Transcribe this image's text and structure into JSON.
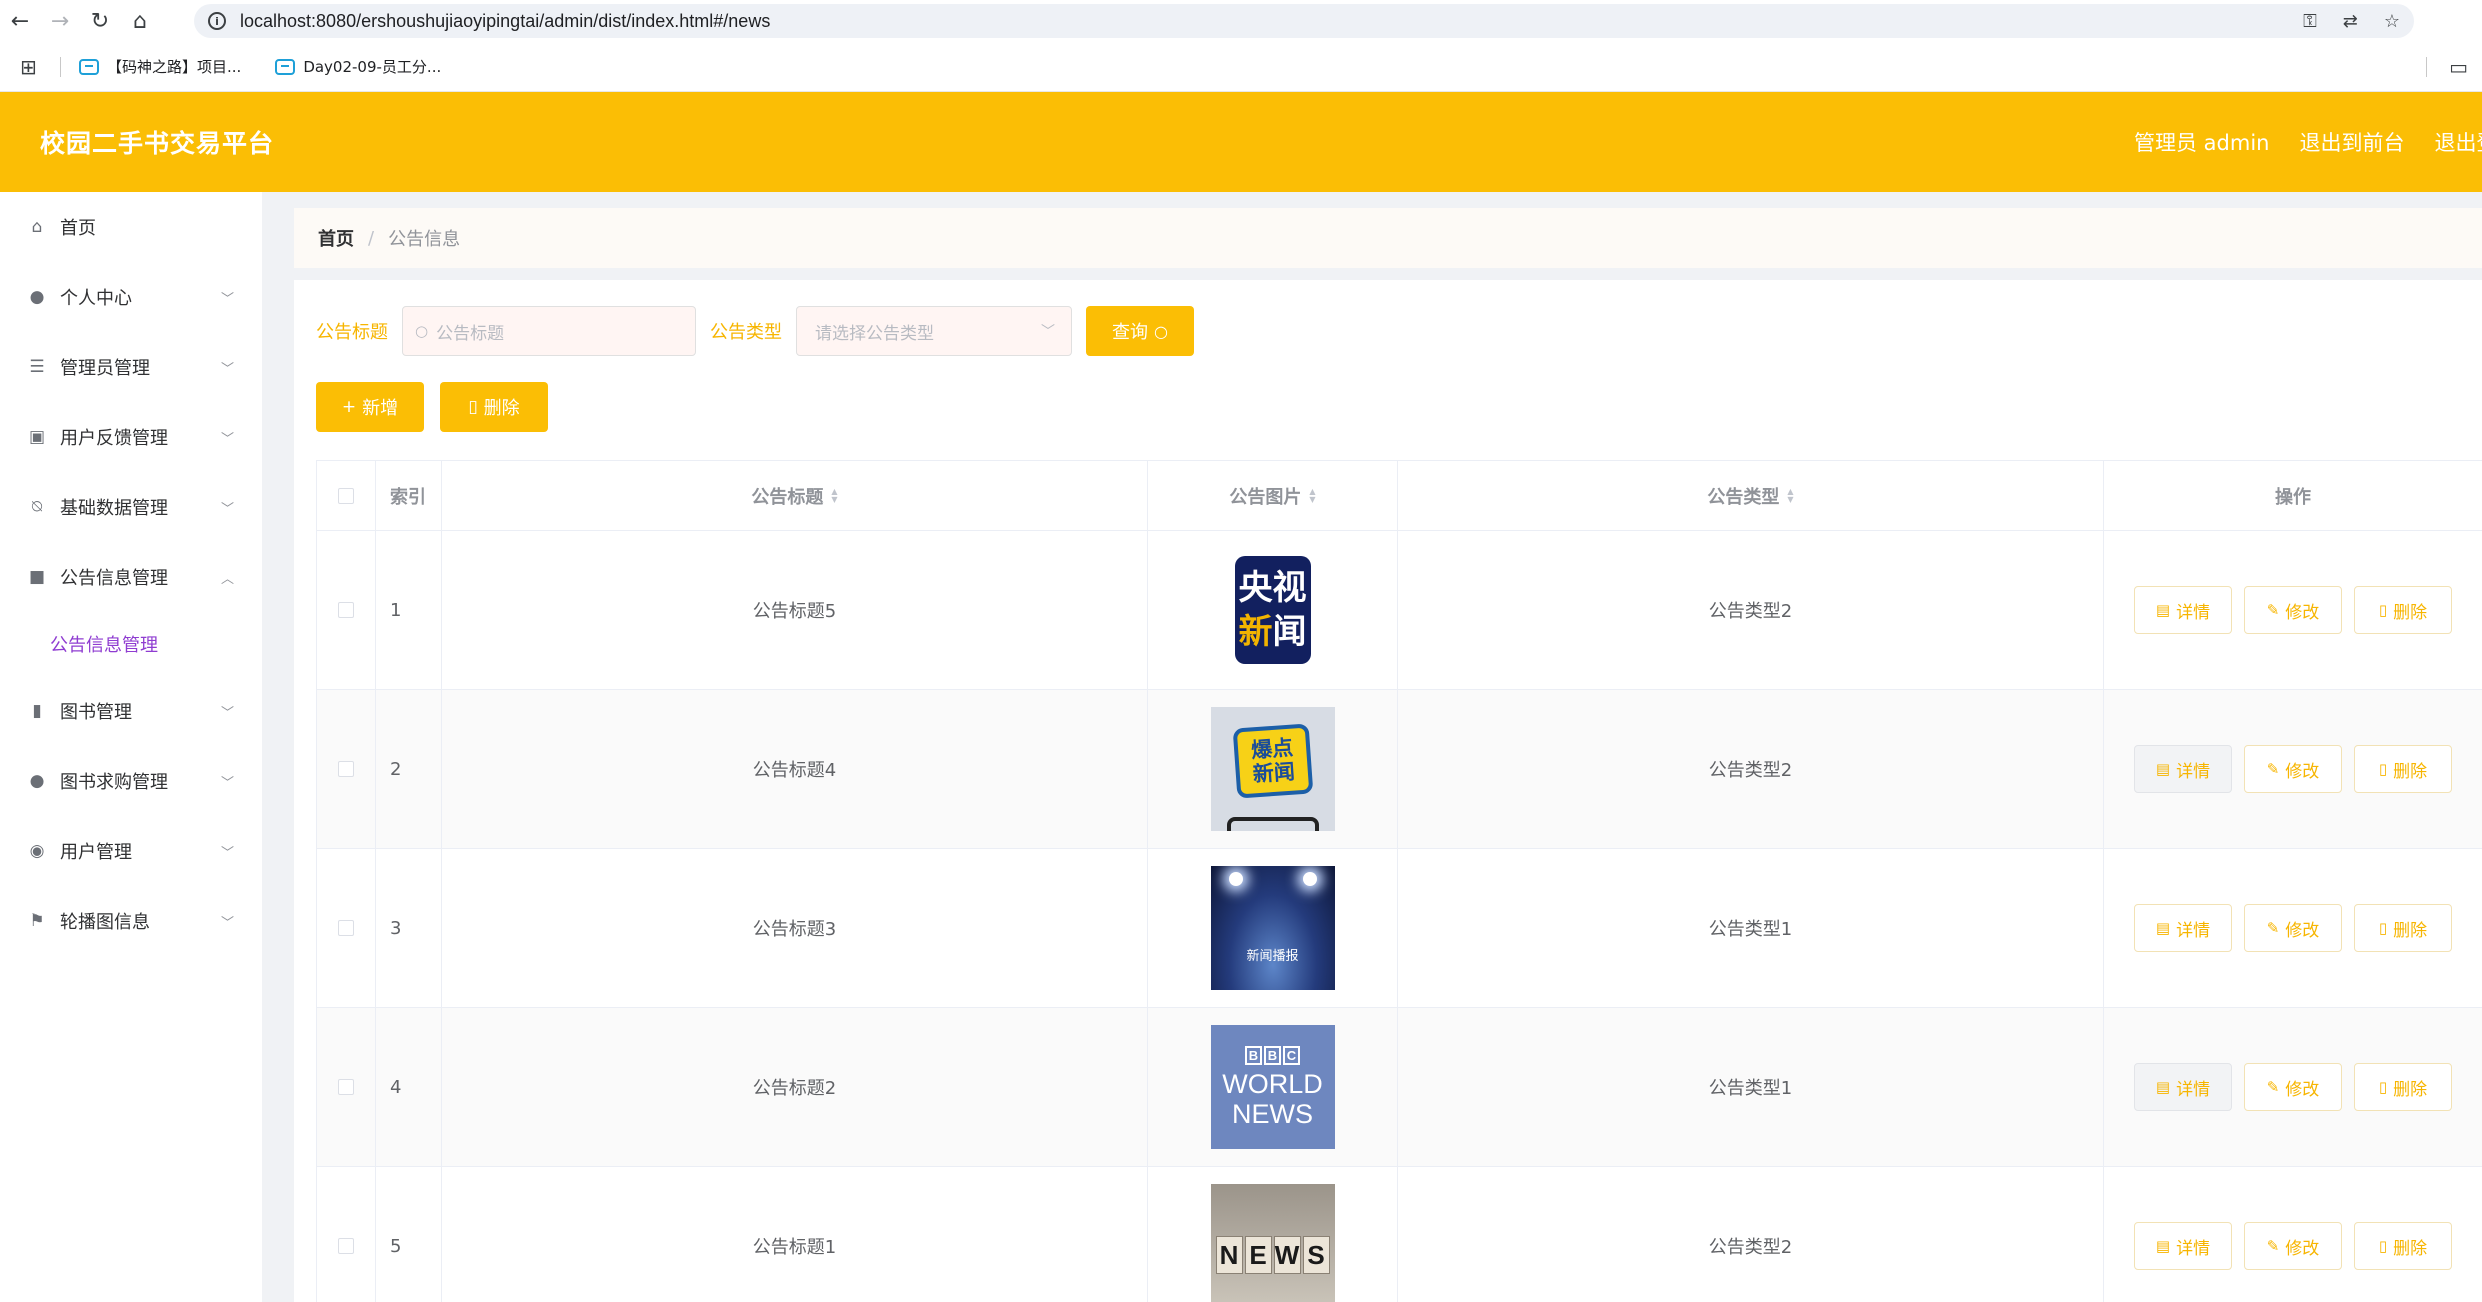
{
  "browser": {
    "back_icon": "arrow-left-icon",
    "forward_icon": "arrow-right-icon",
    "reload_icon": "reload-icon",
    "home_icon": "home-icon",
    "url": "localhost:8080/ershoushujiaoyipingtai/admin/dist/index.html#/news",
    "bookmarks": [
      {
        "label": "【码神之路】项目..."
      },
      {
        "label": "Day02-09-员工分..."
      }
    ]
  },
  "header": {
    "title": "校园二手书交易平台",
    "links": [
      "管理员 admin",
      "退出到前台",
      "退出登录"
    ],
    "accent_color": "#fbbe05"
  },
  "sidebar": {
    "items": [
      {
        "label": "首页",
        "icon": "home-icon",
        "has_arrow": false
      },
      {
        "label": "个人中心",
        "icon": "user-icon",
        "has_arrow": true
      },
      {
        "label": "管理员管理",
        "icon": "sliders-icon",
        "has_arrow": true
      },
      {
        "label": "用户反馈管理",
        "icon": "clipboard-icon",
        "has_arrow": true
      },
      {
        "label": "基础数据管理",
        "icon": "bell-off-icon",
        "has_arrow": true
      },
      {
        "label": "公告信息管理",
        "icon": "camera-icon",
        "has_arrow": true,
        "expanded": true
      },
      {
        "label": "图书管理",
        "icon": "bar-chart-icon",
        "has_arrow": true
      },
      {
        "label": "图书求购管理",
        "icon": "user-icon",
        "has_arrow": true
      },
      {
        "label": "用户管理",
        "icon": "location-icon",
        "has_arrow": true
      },
      {
        "label": "轮播图信息",
        "icon": "flag-icon",
        "has_arrow": true
      }
    ],
    "submenu_item": "公告信息管理",
    "submenu_color": "#8f3cd1"
  },
  "breadcrumb": {
    "home": "首页",
    "separator": "/",
    "current": "公告信息"
  },
  "search": {
    "title_label": "公告标题",
    "title_placeholder": "公告标题",
    "title_value": "",
    "type_label": "公告类型",
    "type_placeholder": "请选择公告类型",
    "query_button": "查询"
  },
  "actions": {
    "add_button": "新增",
    "delete_button": "删除"
  },
  "table": {
    "columns": [
      "索引",
      "公告标题",
      "公告图片",
      "公告类型",
      "操作"
    ],
    "rows": [
      {
        "index": "1",
        "title": "公告标题5",
        "image": "cctv-news-logo",
        "type": "公告类型2"
      },
      {
        "index": "2",
        "title": "公告标题4",
        "image": "breaking-news-phone",
        "type": "公告类型2"
      },
      {
        "index": "3",
        "title": "公告标题3",
        "image": "news-stage-spotlight",
        "type": "公告类型1"
      },
      {
        "index": "4",
        "title": "公告标题2",
        "image": "bbc-world-news-logo",
        "type": "公告类型1"
      },
      {
        "index": "5",
        "title": "公告标题1",
        "image": "news-tiles",
        "type": "公告类型2"
      }
    ],
    "row_actions": {
      "detail": "详情",
      "edit": "修改",
      "delete": "删除"
    }
  },
  "thumbnails": {
    "cctv_line1": "央视",
    "cctv_line2_a": "新",
    "cctv_line2_b": "闻",
    "burst_line1": "爆点",
    "burst_line2": "新闻",
    "stage_caption": "新闻播报",
    "bbc_letters": [
      "B",
      "B",
      "C"
    ],
    "bbc_line1": "WORLD",
    "bbc_line2": "NEWS",
    "tiles": [
      "N",
      "E",
      "W",
      "S"
    ]
  }
}
